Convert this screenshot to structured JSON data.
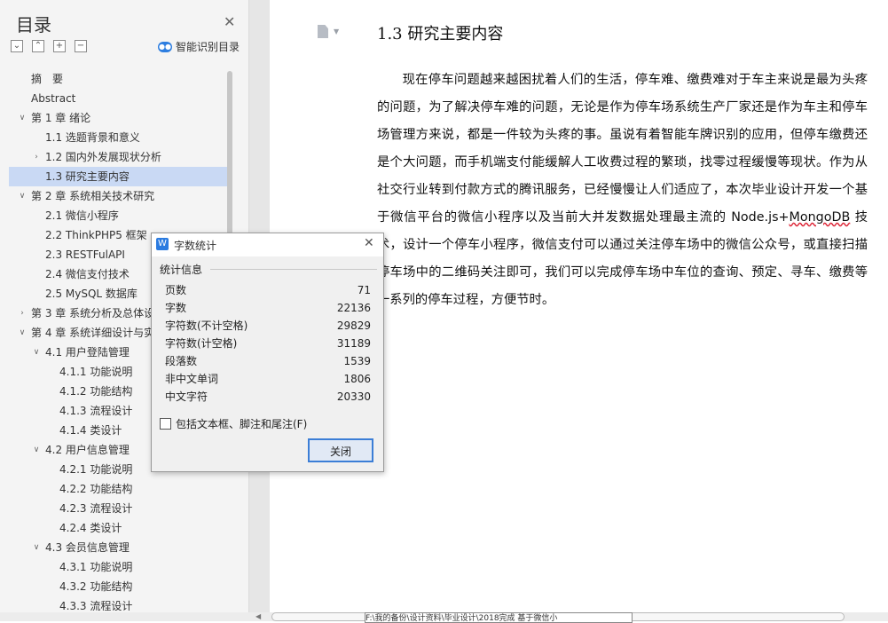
{
  "sidebar": {
    "title": "目录",
    "smart_label": "智能识别目录",
    "tool_glyphs": [
      "⌄",
      "⌃",
      "+",
      "−"
    ],
    "toc": [
      {
        "label": "摘　要",
        "level": 1
      },
      {
        "label": "Abstract",
        "level": 1
      },
      {
        "label": "第 1 章  绪论",
        "level": 1,
        "arrow": "down"
      },
      {
        "label": "1.1  选题背景和意义",
        "level": 2
      },
      {
        "label": "1.2  国内外发展现状分析",
        "level": 2,
        "arrow": "right"
      },
      {
        "label": "1.3  研究主要内容",
        "level": 2,
        "selected": true
      },
      {
        "label": "第 2 章  系统相关技术研究",
        "level": 1,
        "arrow": "down"
      },
      {
        "label": "2.1  微信小程序",
        "level": 2
      },
      {
        "label": "2.2 ThinkPHP5 框架",
        "level": 2
      },
      {
        "label": "2.3 RESTFulAPI",
        "level": 2
      },
      {
        "label": "2.4  微信支付技术",
        "level": 2
      },
      {
        "label": "2.5 MySQL 数据库",
        "level": 2
      },
      {
        "label": "第 3 章  系统分析及总体设",
        "level": 1,
        "arrow": "right"
      },
      {
        "label": "第 4 章  系统详细设计与实",
        "level": 1,
        "arrow": "down"
      },
      {
        "label": "4.1 用户登陆管理",
        "level": 2,
        "arrow": "down"
      },
      {
        "label": "4.1.1 功能说明",
        "level": 3
      },
      {
        "label": "4.1.2 功能结构",
        "level": 3
      },
      {
        "label": "4.1.3 流程设计",
        "level": 3
      },
      {
        "label": "4.1.4 类设计",
        "level": 3
      },
      {
        "label": "4.2 用户信息管理",
        "level": 2,
        "arrow": "down"
      },
      {
        "label": "4.2.1 功能说明",
        "level": 3
      },
      {
        "label": "4.2.2 功能结构",
        "level": 3
      },
      {
        "label": "4.2.3 流程设计",
        "level": 3
      },
      {
        "label": "4.2.4 类设计",
        "level": 3
      },
      {
        "label": "4.3 会员信息管理",
        "level": 2,
        "arrow": "down"
      },
      {
        "label": "4.3.1 功能说明",
        "level": 3
      },
      {
        "label": "4.3.2 功能结构",
        "level": 3
      },
      {
        "label": "4.3.3 流程设计",
        "level": 3
      }
    ]
  },
  "document": {
    "heading": "1.3  研究主要内容",
    "para_before": "现在停车问题越来越困扰着人们的生活，停车难、缴费难对于车主来说是最为头疼的问题，为了解决停车难的问题，无论是作为停车场系统生产厂家还是作为车主和停车场管理方来说，都是一件较为头疼的事。虽说有着智能车牌识别的应用，但停车缴费还是个大问题，而手机端支付能缓解人工收费过程的繁琐，找零过程缓慢等现状。作为从社交行业转到付款方式的腾讯服务，已经慢慢让人们适应了，本次毕业设计开发一个基于微信平台的微信小程序以及当前大并发数据处理最主流的 Node.js+",
    "para_squiggle": "MongoDB",
    "para_after": " 技术，设计一个停车小程序，微信支付可以通过关注停车场中的微信公众号，或直接扫描停车场中的二维码关注即可，我们可以完成停车场中车位的查询、预定、寻车、缴费等一系列的停车过程，方便节时。"
  },
  "status": {
    "path_tip": "F:\\我的备份\\设计资料\\毕业设计\\2018完成 基于微信小"
  },
  "dialog": {
    "title": "字数统计",
    "group": "统计信息",
    "stats": [
      {
        "label": "页数",
        "value": "71"
      },
      {
        "label": "字数",
        "value": "22136"
      },
      {
        "label": "字符数(不计空格)",
        "value": "29829"
      },
      {
        "label": "字符数(计空格)",
        "value": "31189"
      },
      {
        "label": "段落数",
        "value": "1539"
      },
      {
        "label": "非中文单词",
        "value": "1806"
      },
      {
        "label": "中文字符",
        "value": "20330"
      }
    ],
    "checkbox_label": "包括文本框、脚注和尾注(F)",
    "checkbox_checked": false,
    "close_label": "关闭",
    "accent": "#3c7ed6"
  },
  "colors": {
    "sidebar_bg": "#f4f4f4",
    "selected_bg": "#c9d9f4",
    "logo_blue": "#2b7be0"
  }
}
